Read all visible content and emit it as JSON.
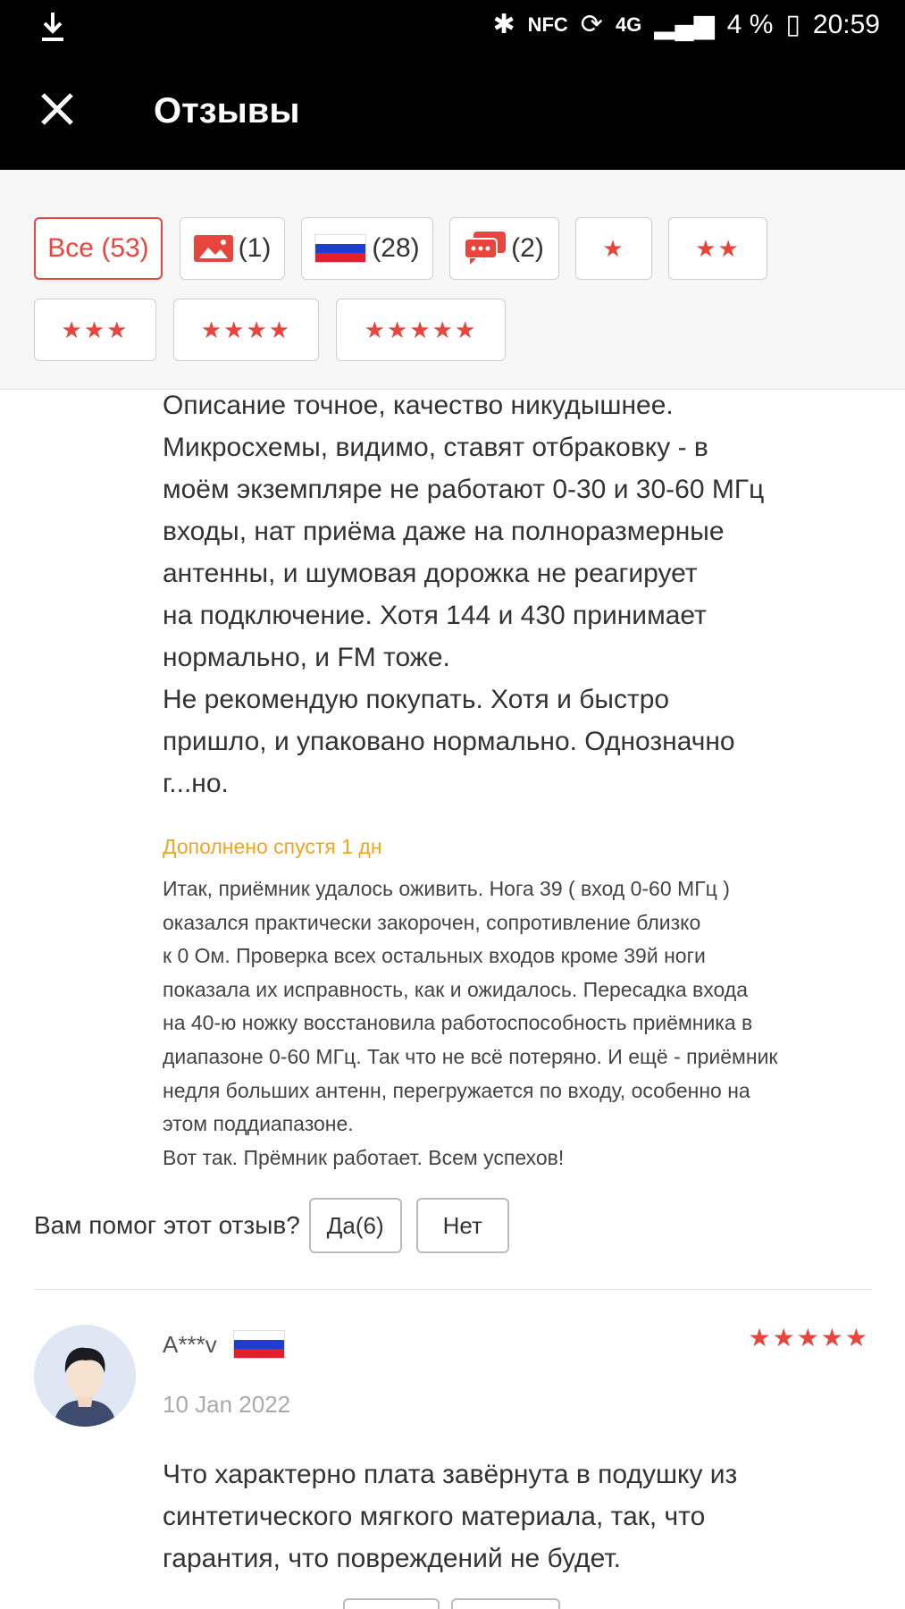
{
  "status_bar": {
    "nfc": "NFC",
    "net": "4G",
    "battery": "4 %",
    "time": "20:59"
  },
  "header": {
    "title": "Отзывы"
  },
  "filters": {
    "all": "Все (53)",
    "photos_count": "(1)",
    "country_count": "(28)",
    "comments_count": "(2)",
    "star1": "★",
    "star2": "★★",
    "star3": "★★★",
    "star4": "★★★★",
    "star5": "★★★★★"
  },
  "review1": {
    "text": "Описание точное, качество никудышнее.\nМикросхемы, видимо, ставят отбраковку - в\nмоём экземпляре не работают 0-30 и 30-60 МГц\nвходы, нат приёма даже на полноразмерные\nантенны, и шумовая дорожка не реагирует\nна подключение. Хотя 144 и 430 принимает\nнормально, и FM тоже.\nНе рекомендую покупать. Хотя и быстро\nпришло, и упаковано нормально. Однозначно\nг...но.",
    "added_label": "Дополнено спустя 1 дн",
    "added_text": "Итак, приёмник удалось оживить. Нога 39 ( вход 0-60 МГц )\nоказался практически закорочен, сопротивление близко\nк 0 Ом. Проверка всех остальных входов кроме 39й ноги\nпоказала их исправность, как и ожидалось. Пересадка входа\nна 40-ю ножку восстановила работоспособность приёмника в\nдиапазоне 0-60 МГц. Так что не всё потеряно. И ещё - приёмник\nнедля больших антенн, перегружается по входу, особенно на\nэтом поддиапазоне.\nВот так. Прёмник работает. Всем успехов!",
    "helpful_question": "Вам помог этот отзыв?",
    "yes": "Да(6)",
    "no": "Нет"
  },
  "review2": {
    "author": "A***v",
    "stars": "★★★★★",
    "date": "10 Jan 2022",
    "text": "Что характерно плата завёрнута в подушку из\nсинтетического мягкого материала, так, что\nгарантия, что повреждений не будет."
  },
  "colors": {
    "accent": "#e8453c",
    "added_label": "#f0a520"
  }
}
